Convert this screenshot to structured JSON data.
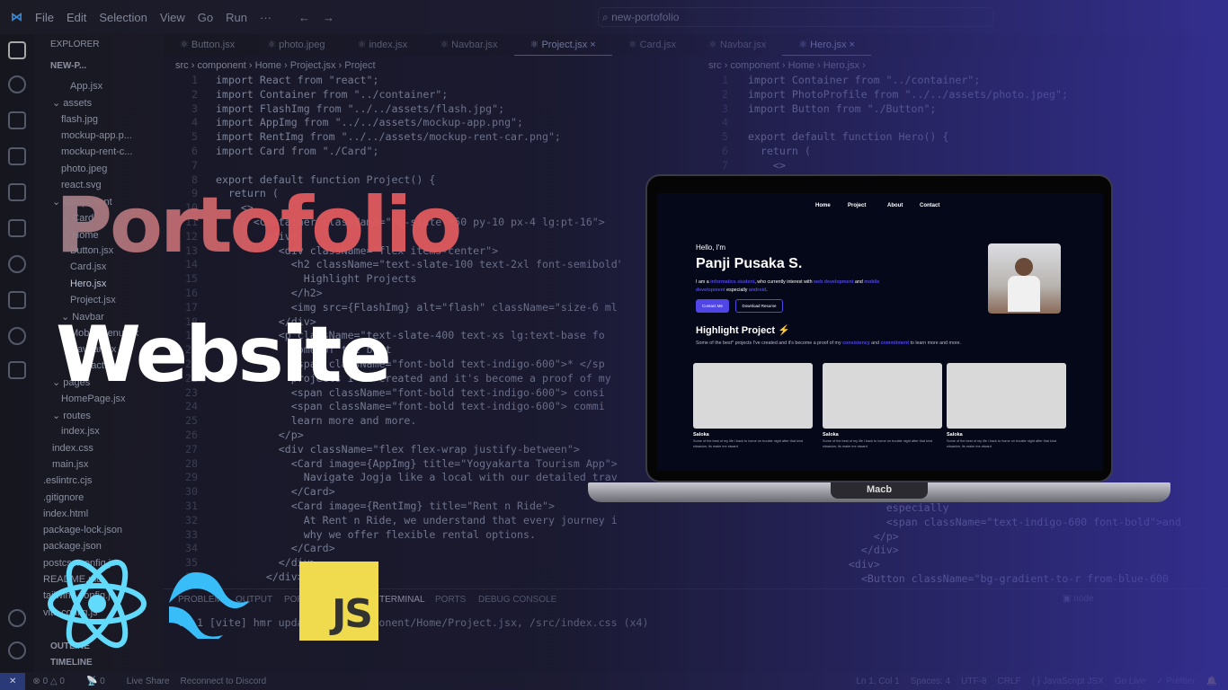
{
  "titlebar": {
    "menus": [
      "File",
      "Edit",
      "Selection",
      "View",
      "Go",
      "Run",
      "···"
    ],
    "search": "new-portofolio"
  },
  "explorer": {
    "title": "EXPLORER",
    "root": "NEW-P...",
    "items": [
      "App.jsx",
      "assets",
      "flash.jpg",
      "mockup-app.p...",
      "mockup-rent-c...",
      "photo.jpeg",
      "react.svg",
      "component",
      "Card",
      "Home",
      "Button.jsx",
      "Card.jsx",
      "Hero.jsx",
      "Project.jsx",
      "Navbar",
      "MobileMenu.jsx",
      "Navbar.jsx",
      "Contact.jsx",
      "pages",
      "HomePage.jsx",
      "routes",
      "index.jsx",
      "index.css",
      "main.jsx",
      ".eslintrc.cjs",
      ".gitignore",
      "index.html",
      "package-lock.json",
      "package.json",
      "postcss.config.js",
      "README.md",
      "tailwind.config.js",
      "vite.config.js"
    ],
    "outline": "OUTLINE",
    "timeline": "TIMELINE"
  },
  "tabs": [
    "Button.jsx",
    "photo.jpeg",
    "index.jsx",
    "Navbar.jsx",
    "Project.jsx",
    "Card.jsx",
    "Navbar.jsx",
    "Hero.jsx"
  ],
  "left_editor": {
    "breadcrumb": "src › component › Home › Project.jsx › Project",
    "lines": [
      "import React from \"react\";",
      "import Container from \"../container\";",
      "import FlashImg from \"../../assets/flash.jpg\";",
      "import AppImg from \"../../assets/mockup-app.png\";",
      "import RentImg from \"../../assets/mockup-rent-car.png\";",
      "import Card from \"./Card\";",
      "",
      "export default function Project() {",
      "  return (",
      "    <>",
      "      <Container className=\"bg-slate-950 py-10 px-4 lg:pt-16\">",
      "        <div>",
      "          <div className=\"flex items-center\">",
      "            <h2 className=\"text-slate-100 text-2xl font-semibold\">",
      "              Highlight Projects",
      "            </h2>",
      "            <img src={FlashImg} alt=\"flash\" className=\"size-6 ml",
      "          </div>",
      "          <p className=\"text-slate-400 text-xs lg:text-base fo",
      "            Some of the best",
      "            <span className=\"font-bold text-indigo-600\">* </sp",
      "            projects I've created and it's become a proof of my",
      "            <span className=\"font-bold text-indigo-600\"> consi",
      "            <span className=\"font-bold text-indigo-600\"> commi",
      "            learn more and more.",
      "          </p>",
      "          <div className=\"flex flex-wrap justify-between\">",
      "            <Card image={AppImg} title=\"Yogyakarta Tourism App\">",
      "              Navigate Jogja like a local with our detailed trav",
      "            </Card>",
      "            <Card image={RentImg} title=\"Rent n Ride\">",
      "              At Rent n Ride, we understand that every journey i",
      "              why we offer flexible rental options.",
      "            </Card>",
      "          </div>",
      "        </div>"
    ]
  },
  "right_editor": {
    "breadcrumb": "src › component › Home › Hero.jsx ›",
    "lines": [
      "import Container from \"../container\";",
      "import PhotoProfile from \"../../assets/photo.jpeg\";",
      "import Button from \"./Button\";",
      "",
      "export default function Hero() {",
      "  return (",
      "    <>"
    ],
    "tail_lines": [
      "          especially",
      "          <span className=\"text-indigo-600 font-bold\">and",
      "        </p>",
      "      </div>",
      "    <div>",
      "      <Button className=\"bg-gradient-to-r from-blue-600"
    ]
  },
  "panel": {
    "tabs": [
      "PROBLEMS",
      "OUTPUT",
      "PORTS",
      "TERMINAL",
      "PORTS",
      "DEBUG CONSOLE"
    ],
    "terminal_line": "08:1 [vite] hmr update /src/component/Home/Project.jsx, /src/index.css (x4)",
    "shell": "node"
  },
  "status": {
    "left": [
      "0 △ 0",
      "0",
      "Live Share",
      "Reconnect to Discord"
    ],
    "right": [
      "Ln 1, Col 1",
      "Spaces: 4",
      "UTF-8",
      "CRLF",
      "{ } JavaScript JSX",
      "Go Live",
      "✓ Prettier"
    ]
  },
  "headline": {
    "line1": "Portofolio",
    "line2": "Website"
  },
  "laptop": {
    "brand": "Macb",
    "site": {
      "nav": [
        "Home",
        "Project",
        "About",
        "Contact"
      ],
      "greeting": "Hello, I'm",
      "name": "Panji Pusaka S.",
      "intro": [
        "I am a ",
        "informatics student",
        ", who currently interest with ",
        "web development",
        " and ",
        "mobile development",
        " especially ",
        "android",
        "."
      ],
      "btn_contact": "Contact Me",
      "btn_resume": "Download Resume",
      "section_title": "Highlight Project",
      "section_desc": [
        "Some of the best* projects I've created and it's become a proof of my ",
        "consistency",
        " and ",
        "commitment",
        " to learn more and more."
      ],
      "cards": [
        {
          "title": "Saloka",
          "desc": "Some of the best of my life i back to home on trouble night after that kind situasion, its make me alward"
        },
        {
          "title": "Saloka",
          "desc": "Some of the best of my life i back to home on trouble night after that kind situasion, its make me alward"
        },
        {
          "title": "Saloka",
          "desc": "Some of the best of my life i back to home on trouble night after that kind situasion, its make me alward"
        }
      ]
    }
  },
  "logos": {
    "js": "JS",
    "react": "react-logo",
    "tailwind": "tailwind-logo"
  },
  "colors": {
    "title_red": "#e15a5e",
    "accent_indigo": "#4f46e5",
    "js_yellow": "#f0db4f",
    "react_cyan": "#61dafb",
    "tailwind_cyan": "#38bdf8"
  }
}
